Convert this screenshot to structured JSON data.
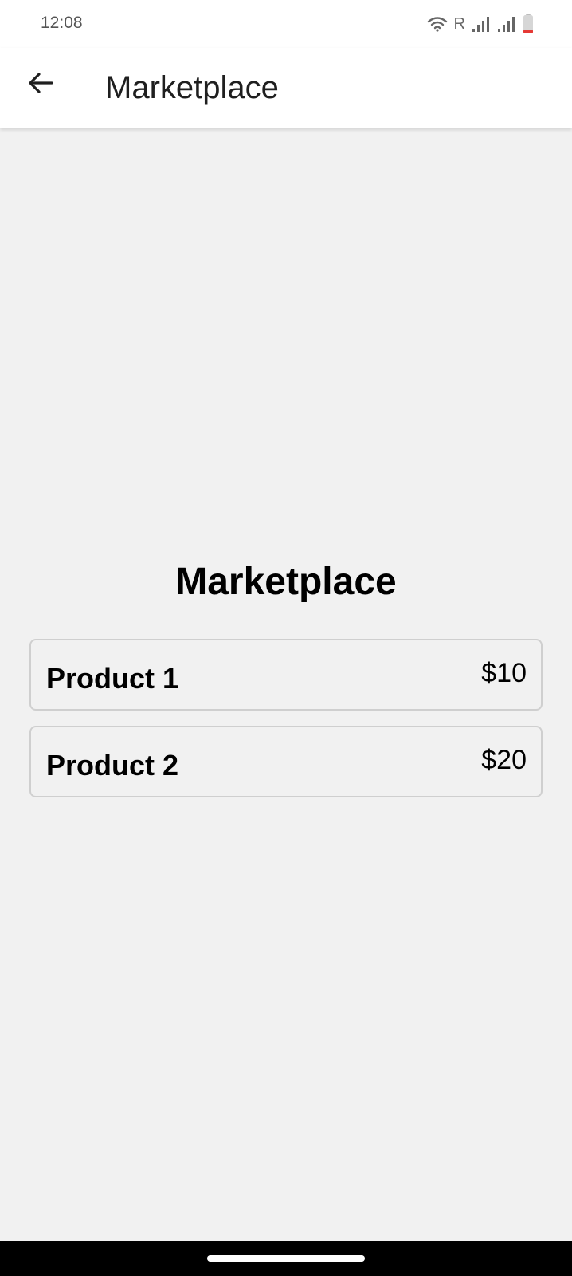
{
  "status_bar": {
    "time": "12:08",
    "roaming_indicator": "R",
    "icons": [
      "wifi-icon",
      "signal-icon",
      "signal-icon",
      "battery-low-icon"
    ],
    "battery_color": "#e53935"
  },
  "app_bar": {
    "back_icon": "arrow-left-icon",
    "title": "Marketplace"
  },
  "main": {
    "title": "Marketplace",
    "products": [
      {
        "name": "Product 1",
        "price": "$10"
      },
      {
        "name": "Product 2",
        "price": "$20"
      }
    ]
  },
  "nav_bar": {
    "home_indicator": "home-indicator"
  }
}
